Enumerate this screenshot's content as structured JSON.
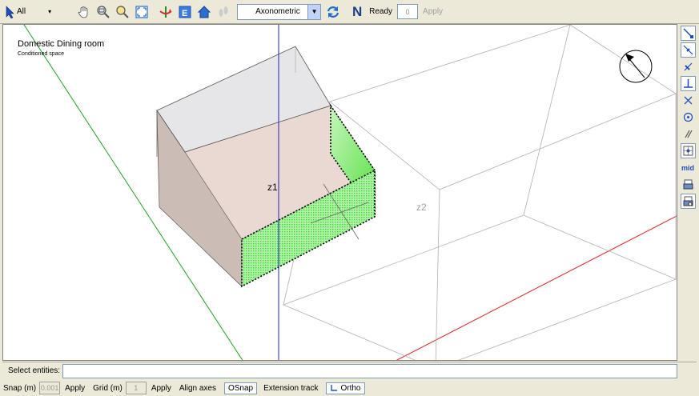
{
  "toolbar": {
    "select_mode": "All",
    "view_mode": "Axonometric",
    "north_label": "N",
    "status": "Ready",
    "count_value": "0",
    "apply_label": "Apply",
    "icons": [
      "select-arrow-icon",
      "pan-hand-icon",
      "zoom-window-icon",
      "zoom-extents-icon",
      "fit-view-icon",
      "rotate-view-icon",
      "elevation-icon",
      "house-icon",
      "footprints-icon",
      "view-icon",
      "refresh-icon",
      "north-icon"
    ]
  },
  "viewport": {
    "zone_title": "Domestic Dining room",
    "zone_subtitle": "Conditioned space",
    "zone_labels": [
      "z1",
      "z2"
    ]
  },
  "snap_toolbar": {
    "mid_label": "mid",
    "icons": [
      "endpoint-snap-icon",
      "nearest-snap-icon",
      "perpendicular-snap-icon",
      "perpendicular-foot-icon",
      "intersection-snap-icon",
      "center-snap-icon",
      "parallel-snap-icon",
      "grid-snap-icon",
      "midpoint-snap-icon",
      "print-icon",
      "print-settings-icon"
    ]
  },
  "command": {
    "label": "Select entities:",
    "value": ""
  },
  "status_bar": {
    "snap_label": "Snap (m)",
    "snap_value": "0.001",
    "snap_apply": "Apply",
    "grid_label": "Grid (m)",
    "grid_value": "1",
    "grid_apply": "Apply",
    "align_axes": "Align axes",
    "osnap": "OSnap",
    "extension_track": "Extension track",
    "ortho": "Ortho"
  },
  "colors": {
    "selected_face": "#33dd33",
    "zone_fill": "#e8d8d0",
    "x_axis": "#e02020",
    "y_axis": "#20a020",
    "z_axis": "#2020c0"
  }
}
